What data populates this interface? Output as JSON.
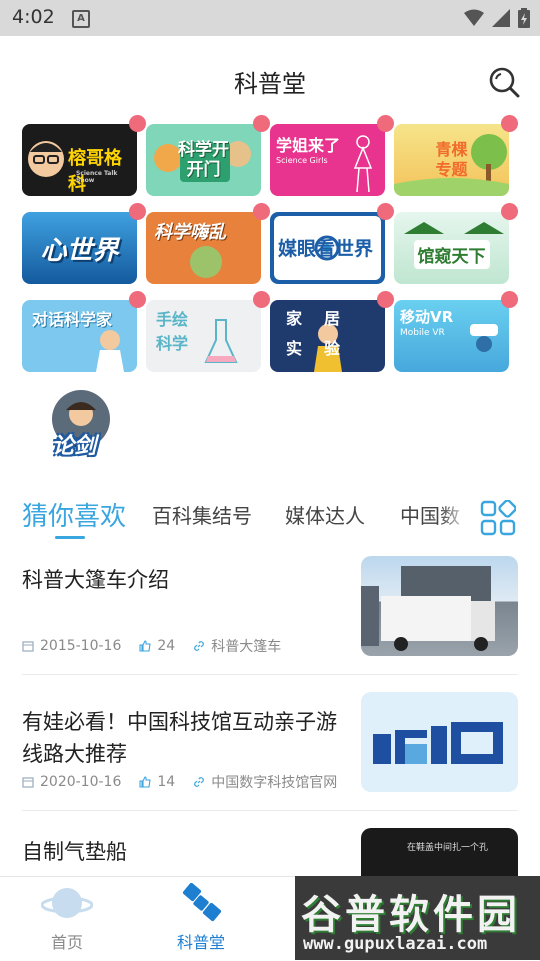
{
  "status_bar": {
    "time": "4:02",
    "notification_icon": "A"
  },
  "header": {
    "title": "科普堂",
    "search_icon": "search-icon"
  },
  "categories": [
    {
      "name": "榕哥格科",
      "subtitle": "Science Talk Show",
      "bg": "#1b1b1b",
      "fg": "#ffd400"
    },
    {
      "name": "科学开开门",
      "bg": "#7fd6b8",
      "fg": "#ffffff"
    },
    {
      "name": "学姐来了",
      "subtitle": "Science Girls",
      "bg": "#e8348f",
      "fg": "#ffffff"
    },
    {
      "name": "青棵专题",
      "bg": "#f4d36a",
      "fg": "#f06b2c"
    },
    {
      "name": "心世界",
      "bg": "#1a78c2",
      "fg": "#ffffff"
    },
    {
      "name": "科学嗨乱",
      "bg": "#e8813c",
      "fg": "#ffffff"
    },
    {
      "name": "媒眼看世界",
      "bg": "#ffffff",
      "fg": "#1c5fa8"
    },
    {
      "name": "馆窥天下",
      "bg": "#d8f0e4",
      "fg": "#2e7d32"
    },
    {
      "name": "对话科学家",
      "bg": "#7cc8ef",
      "fg": "#ffffff"
    },
    {
      "name": "手绘科学",
      "bg": "#e9ecef",
      "fg": "#5ab5c9"
    },
    {
      "name": "家居实验",
      "bg": "#1f3b6e",
      "fg": "#ffffff"
    },
    {
      "name": "移动VR",
      "subtitle": "Mobile VR",
      "bg": "#5fc6e8",
      "fg": "#ffffff"
    }
  ],
  "extra_item": {
    "label": "论剑"
  },
  "tabs": [
    "猜你喜欢",
    "百科集结号",
    "媒体达人",
    "中国数"
  ],
  "articles": [
    {
      "title": "科普大篷车介绍",
      "date": "2015-10-16",
      "likes": "24",
      "source": "科普大篷车"
    },
    {
      "title": "有娃必看！中国科技馆互动亲子游线路大推荐",
      "date": "2020-10-16",
      "likes": "14",
      "source": "中国数字科技馆官网"
    },
    {
      "title": "自制气垫船",
      "thumb_caption": "在鞋盖中间扎一个孔"
    }
  ],
  "bottom_nav": [
    {
      "label": "首页",
      "icon": "planet-icon"
    },
    {
      "label": "科普堂",
      "icon": "satellite-icon"
    }
  ],
  "watermark": {
    "line1": "谷普软件园",
    "line2": "www.gupuxlazai.com"
  },
  "colors": {
    "accent": "#3aa6e0",
    "nav_active": "#1e7fd0",
    "badge": "#ef6a7b"
  }
}
